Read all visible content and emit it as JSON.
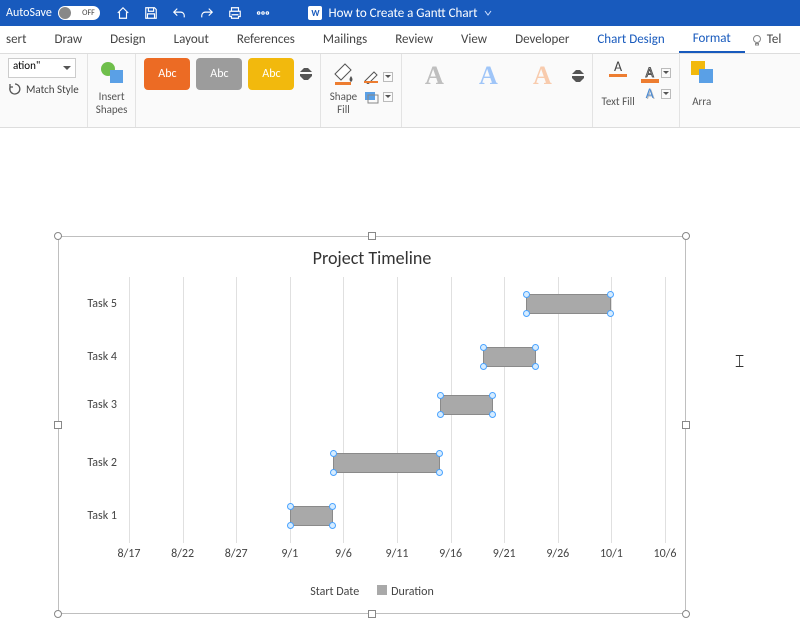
{
  "titlebar": {
    "autosave": "AutoSave",
    "autosave_state": "OFF",
    "document_name": "How to Create a Gantt Chart"
  },
  "tabs": {
    "insert": "sert",
    "draw": "Draw",
    "design": "Design",
    "layout": "Layout",
    "references": "References",
    "mailings": "Mailings",
    "review": "Review",
    "view": "View",
    "developer": "Developer",
    "chart_design": "Chart Design",
    "format": "Format",
    "tell": "Tel"
  },
  "ribbon": {
    "selection_combo": "ation\"",
    "match_style": "Match Style",
    "insert_shapes": "Insert\nShapes",
    "abc": "Abc",
    "shape_fill": "Shape\nFill",
    "text_fill": "Text Fill",
    "arrange": "Arra"
  },
  "chart_data": {
    "type": "bar",
    "title": "Project Timeline",
    "x_axis_label": "",
    "y_axis_label": "",
    "x_ticks": [
      "8/17",
      "8/22",
      "8/27",
      "9/1",
      "9/6",
      "9/11",
      "9/16",
      "9/21",
      "9/26",
      "10/1",
      "10/6"
    ],
    "categories_top_to_bottom": [
      "Task 5",
      "Task 4",
      "Task 3",
      "Task 2",
      "Task 1"
    ],
    "series": [
      {
        "name": "Start Date",
        "role": "offset-hidden",
        "values_by_task": {
          "Task 1": "9/1",
          "Task 2": "9/5",
          "Task 3": "9/15",
          "Task 4": "9/19",
          "Task 5": "9/23"
        }
      },
      {
        "name": "Duration",
        "role": "visible-bar-days",
        "values_by_task": {
          "Task 1": 4,
          "Task 2": 10,
          "Task 3": 5,
          "Task 4": 5,
          "Task 5": 8
        }
      }
    ],
    "legend": {
      "items": [
        "Start Date",
        "Duration"
      ],
      "position": "bottom"
    },
    "xlim_domain_days_from_8_17": [
      0,
      50
    ]
  }
}
